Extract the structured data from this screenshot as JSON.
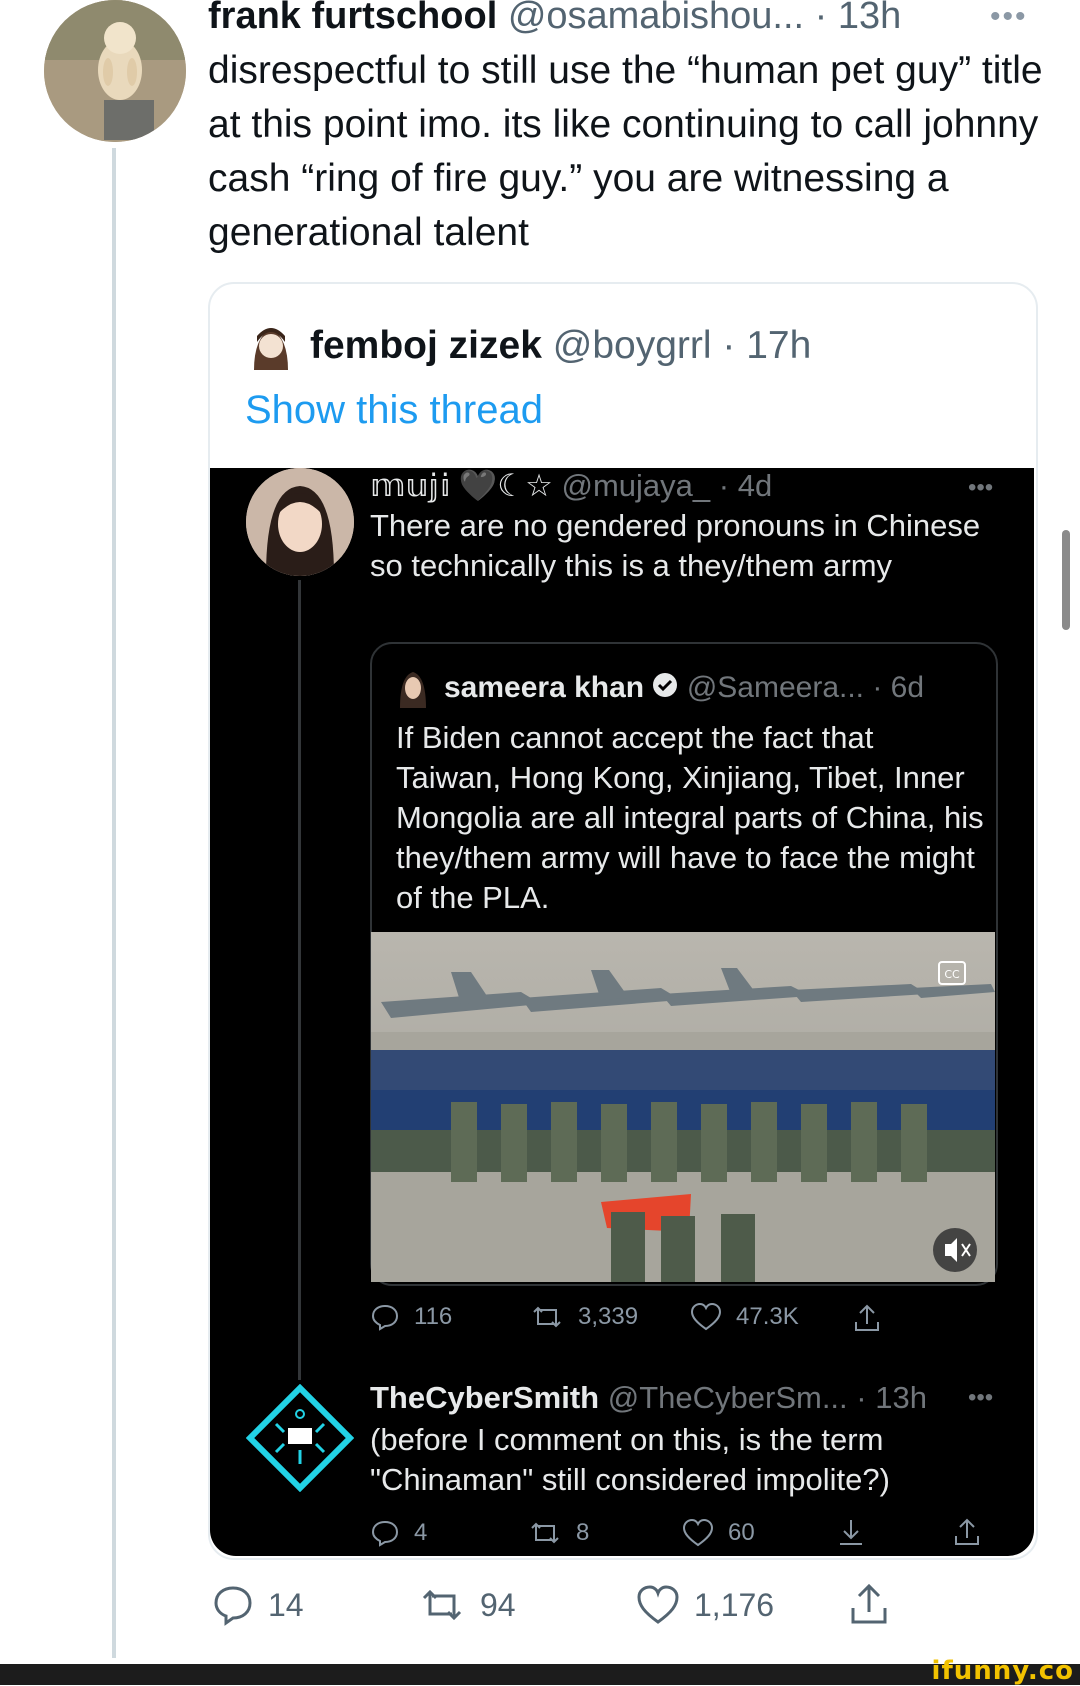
{
  "outer_tweet": {
    "display_name": "frank furtschool",
    "handle": "@osamabishou...",
    "time": "· 13h",
    "more": "•••",
    "text": "disrespectful to still use the “human pet guy” title at this point imo. its like continuing to call johnny cash “ring of fire guy.” you are witnessing a generational talent",
    "replies": "14",
    "retweets": "94",
    "likes": "1,176"
  },
  "quoted_tweet": {
    "display_name": "femboj zizek",
    "handle": "@boygrrl",
    "time": "· 17h",
    "show_thread": "Show this thread"
  },
  "screenshot": {
    "tweet1": {
      "display_name": "𝕞𝕦𝕛𝕚 🖤☾☆",
      "handle": "@mujaya_",
      "time": "· 4d",
      "more": "•••",
      "text": "There are no gendered pronouns in Chinese so technically this is a they/them army",
      "replies": "116",
      "retweets": "3,339",
      "likes": "47.3K"
    },
    "quoted": {
      "display_name": "sameera khan",
      "handle": "@Sameera...",
      "time": "· 6d",
      "text": "If Biden cannot accept the fact that Taiwan, Hong Kong, Xinjiang, Tibet, Inner Mongolia are all integral parts of China, his they/them army will have to face the might of the PLA."
    },
    "tweet2": {
      "display_name": "TheCyberSmith",
      "handle": "@TheCyberSm...",
      "time": "· 13h",
      "more": "•••",
      "text": "(before I comment on this, is the term \"Chinaman\" still considered impolite?)",
      "replies": "4",
      "retweets": "8",
      "likes": "60"
    }
  },
  "watermark": "ifunny.co",
  "colors": {
    "link_blue": "#1d9bf0",
    "dark_bg": "#000000",
    "muted_gray": "#536471"
  }
}
